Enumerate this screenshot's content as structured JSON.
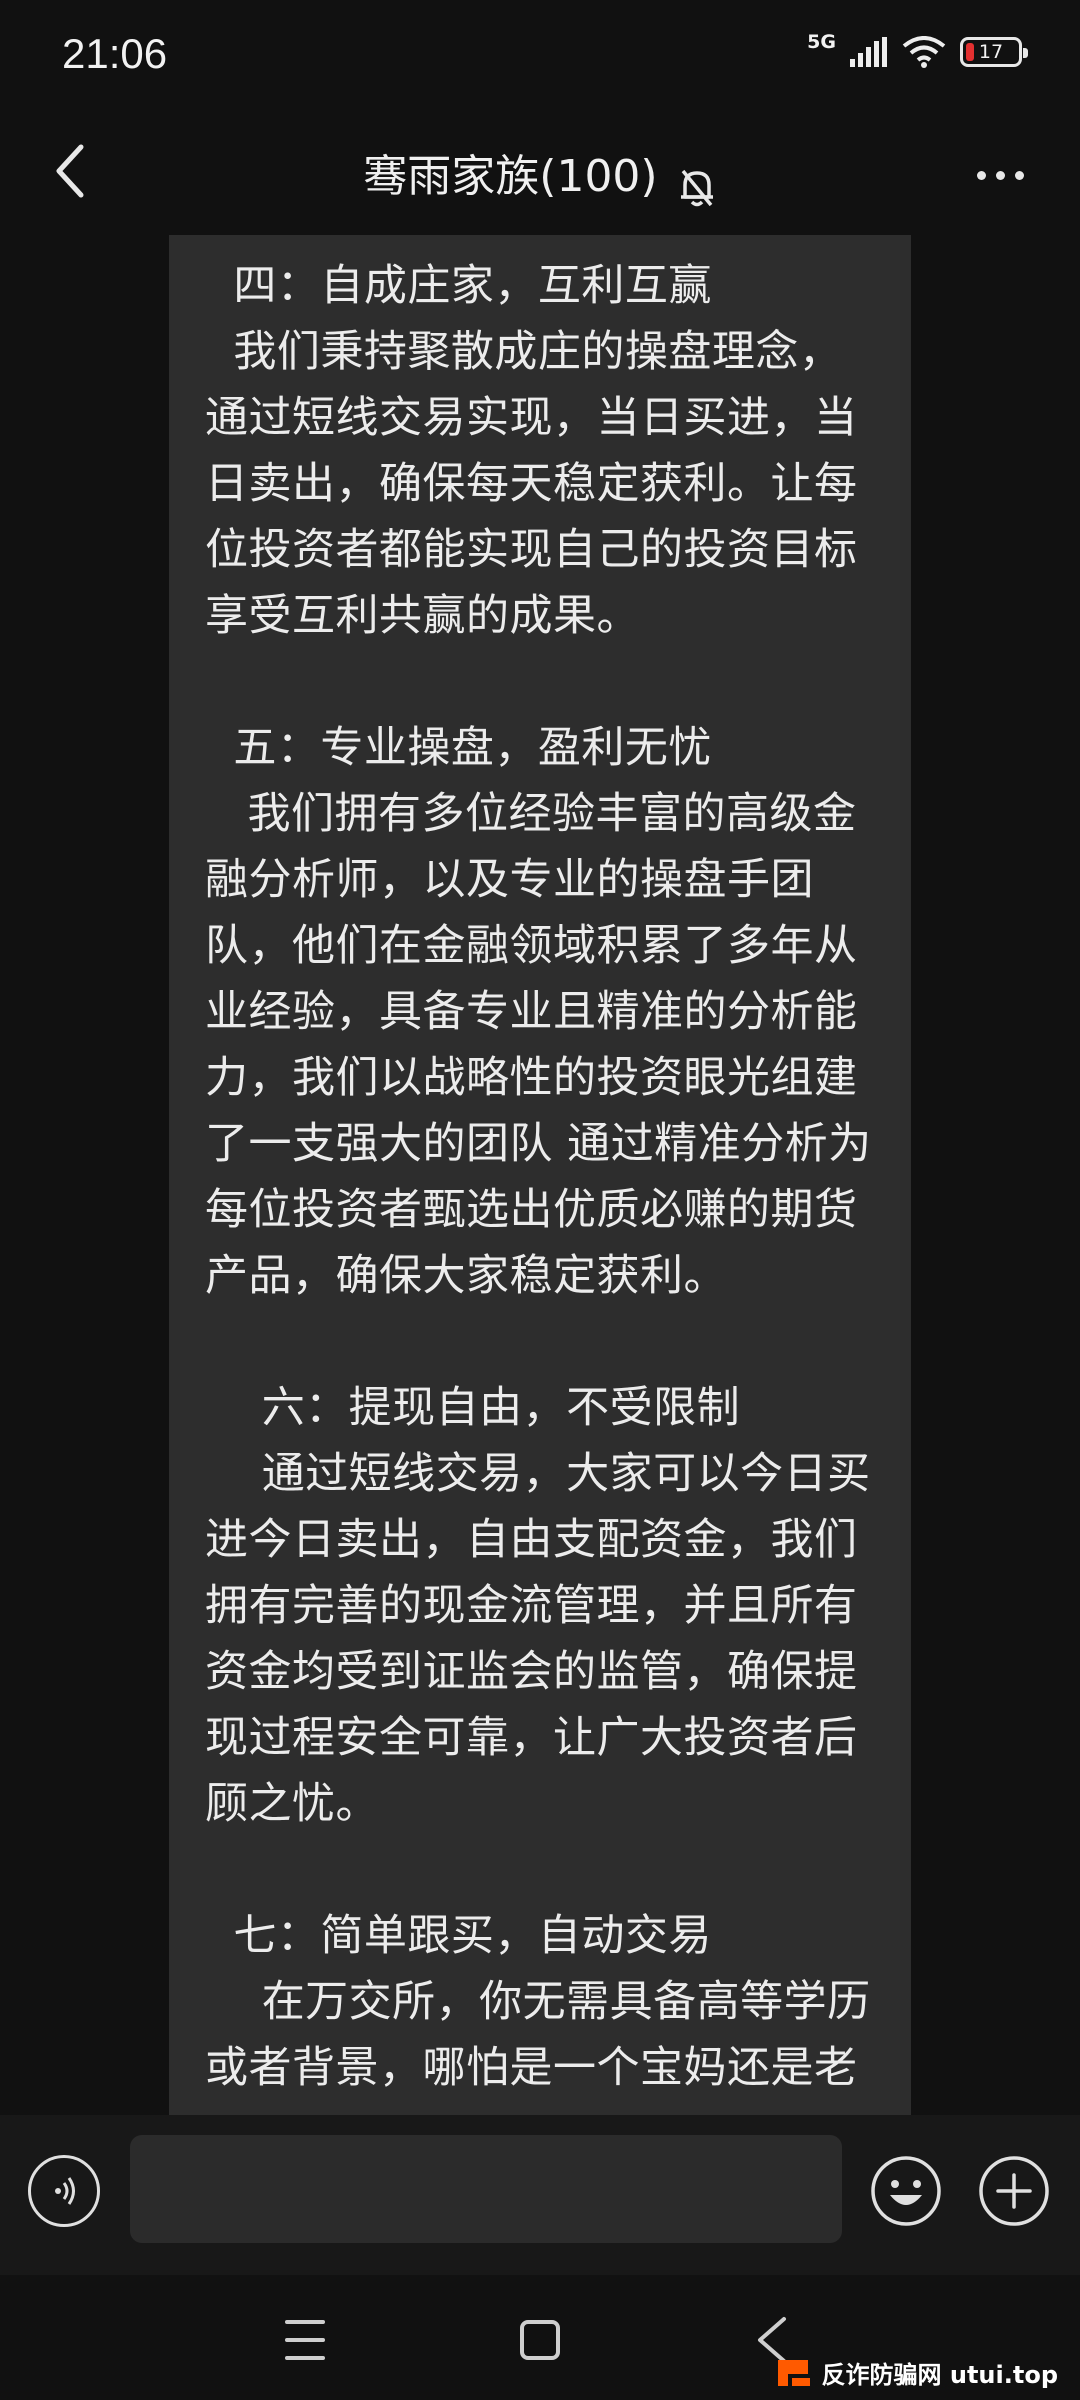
{
  "status_bar": {
    "time": "21:06",
    "network": "5G",
    "battery_level": "17",
    "battery_color": "#e33030"
  },
  "header": {
    "title": "骞雨家族(100)",
    "back_icon": "chevron-left-icon",
    "mute_icon": "bell-off-icon",
    "more_icon": "more-horizontal-icon"
  },
  "message": {
    "text": "  四：自成庄家，互利互赢\n  我们秉持聚散成庄的操盘理念，通过短线交易实现，当日买进，当日卖出，确保每天稳定获利。让每位投资者都能实现自己的投资目标 享受互利共赢的成果。\n\n  五：专业操盘，盈利无忧\n   我们拥有多位经验丰富的高级金融分析师，以及专业的操盘手团队，他们在金融领域积累了多年从业经验，具备专业且精准的分析能力，我们以战略性的投资眼光组建了一支强大的团队 通过精准分析为每位投资者甄选出优质必赚的期货产品，确保大家稳定获利。\n\n    六：提现自由，不受限制\n    通过短线交易，大家可以今日买进今日卖出，自由支配资金，我们拥有完善的现金流管理，并且所有资金均受到证监会的监管，确保提现过程安全可靠，让广大投资者后顾之忧。\n\n  七：简单跟买，自动交易\n    在万交所，你无需具备高等学历或者背景，哪怕是一个宝妈还是老"
  },
  "input_bar": {
    "voice_icon": "voice-icon",
    "text_value": "",
    "emoji_icon": "emoji-icon",
    "plus_icon": "plus-icon"
  },
  "nav_bar": {
    "menu_icon": "menu-icon",
    "home_icon": "home-square-icon",
    "back_icon": "back-chevron-icon"
  },
  "watermark": {
    "brand_text": "反诈防骗网 utui.top",
    "brand_color": "#ff5a00"
  }
}
